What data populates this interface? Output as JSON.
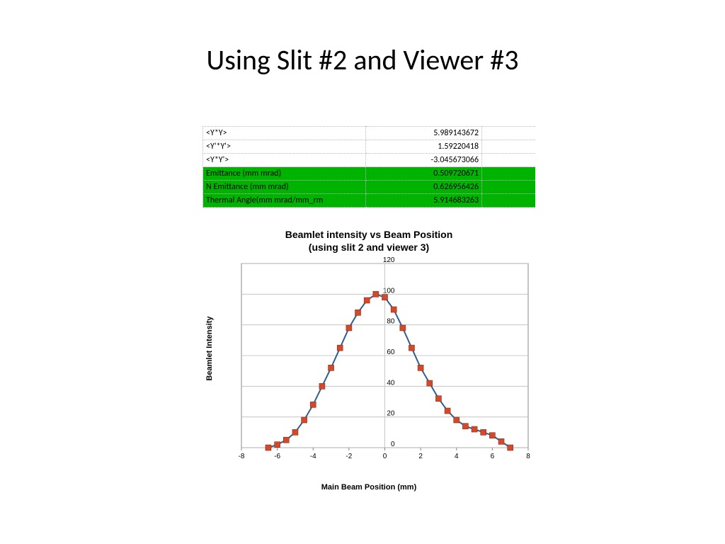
{
  "title": "Using Slit #2 and Viewer #3",
  "params": {
    "rows": [
      {
        "label": "<Y*Y>",
        "value": "5.989143672",
        "hl": false
      },
      {
        "label": "<Y'*Y'>",
        "value": "1.59220418",
        "hl": false
      },
      {
        "label": "<Y*Y'>",
        "value": "-3.045673066",
        "hl": false
      },
      {
        "label": "Emittance (mm mrad)",
        "value": "0.509720671",
        "hl": true
      },
      {
        "label": "N Emittance (mm mrad)",
        "value": "0.626956426",
        "hl": true
      },
      {
        "label": "Thermal Angle(mm mrad/mm_rm",
        "value": "5.914683263",
        "hl": true
      }
    ]
  },
  "chart_data": {
    "type": "line",
    "title": "Beamlet intensity vs Beam Position",
    "subtitle": "(using slit 2 and viewer 3)",
    "xlabel": "Main Beam Position (mm)",
    "ylabel": "Beamlet Intensity",
    "xlim": [
      -8,
      8
    ],
    "ylim": [
      0,
      120
    ],
    "xticks": [
      -8,
      -6,
      -4,
      -2,
      0,
      2,
      4,
      6,
      8
    ],
    "yticks": [
      0,
      20,
      40,
      60,
      80,
      100,
      120
    ],
    "x": [
      -6.5,
      -6.0,
      -5.5,
      -5.0,
      -4.5,
      -4.0,
      -3.5,
      -3.0,
      -2.5,
      -2.0,
      -1.5,
      -1.0,
      -0.5,
      0.0,
      0.5,
      1.0,
      1.5,
      2.0,
      2.5,
      3.0,
      3.5,
      4.0,
      4.5,
      5.0,
      5.5,
      6.0,
      6.5,
      7.0
    ],
    "y": [
      0,
      2,
      5,
      10,
      18,
      28,
      40,
      52,
      65,
      78,
      88,
      96,
      100,
      98,
      90,
      78,
      65,
      52,
      42,
      32,
      24,
      18,
      14,
      12,
      10,
      8,
      4,
      0
    ],
    "marker_color": "#d24a2b",
    "line_color": "#2f5f8f"
  }
}
